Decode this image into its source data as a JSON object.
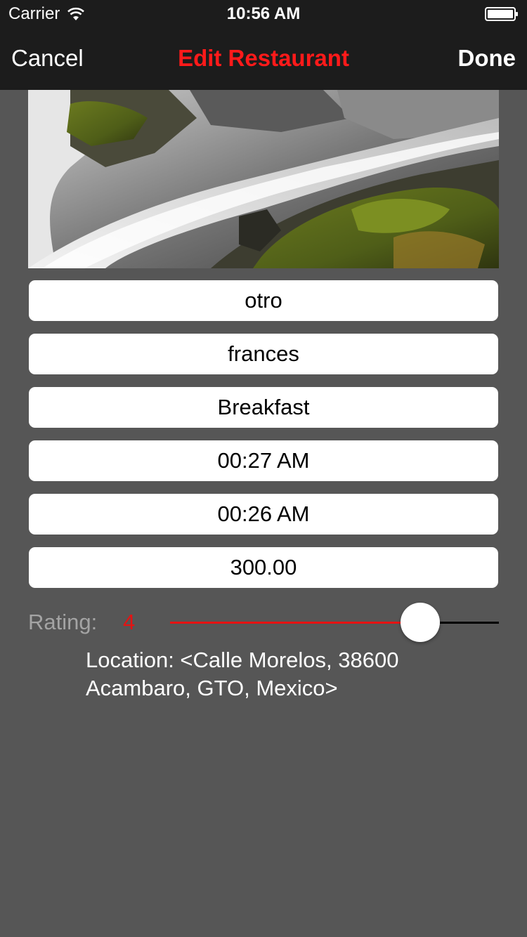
{
  "status_bar": {
    "carrier": "Carrier",
    "time": "10:56 AM"
  },
  "nav": {
    "cancel_label": "Cancel",
    "title": "Edit Restaurant",
    "done_label": "Done"
  },
  "photo": {
    "icon": "waterfall-photo"
  },
  "fields": [
    {
      "value": "otro"
    },
    {
      "value": "frances"
    },
    {
      "value": "Breakfast"
    },
    {
      "value": "00:27 AM"
    },
    {
      "value": "00:26 AM"
    },
    {
      "value": "300.00"
    }
  ],
  "rating": {
    "label": "Rating:",
    "value": "4",
    "slider_fraction": 0.76
  },
  "location": {
    "text": "Location: <Calle Morelos, 38600 Acambaro, GTO, Mexico>"
  },
  "colors": {
    "background": "#565656",
    "bar": "#1c1c1c",
    "accent": "#e51212",
    "title": "#ff1a1a"
  }
}
